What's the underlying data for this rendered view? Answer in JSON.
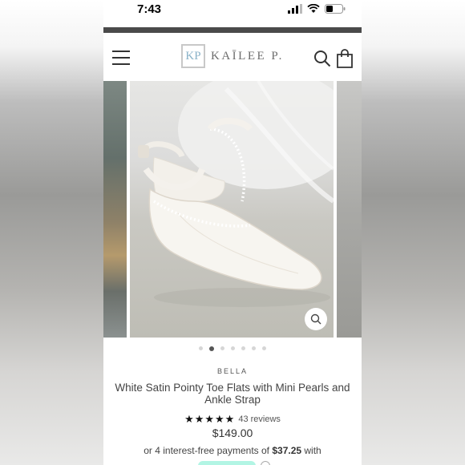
{
  "status_bar": {
    "time": "7:43"
  },
  "header": {
    "logo_monogram": "KP",
    "logo_text": "KAĪLEE P."
  },
  "carousel": {
    "total_slides": 7,
    "active_index": 1
  },
  "product": {
    "vendor": "BELLA",
    "title": "White Satin Pointy Toe Flats with Mini Pearls and Ankle Strap",
    "rating": 5,
    "stars": "★★★★★",
    "reviews": "43 reviews",
    "price": "$149.00",
    "payments_prefix": "or 4 interest-free payments of",
    "payments_amount": "$37.25",
    "payments_suffix": "with"
  },
  "colors": {
    "topbar": "#4a4a4a",
    "logo_accent": "#8ab2c8",
    "payment_badge": "#b2f5e4"
  },
  "icons": [
    "signal-icon",
    "wifi-icon",
    "battery-icon",
    "hamburger-menu-icon",
    "search-icon",
    "cart-icon",
    "zoom-icon",
    "info-icon"
  ]
}
